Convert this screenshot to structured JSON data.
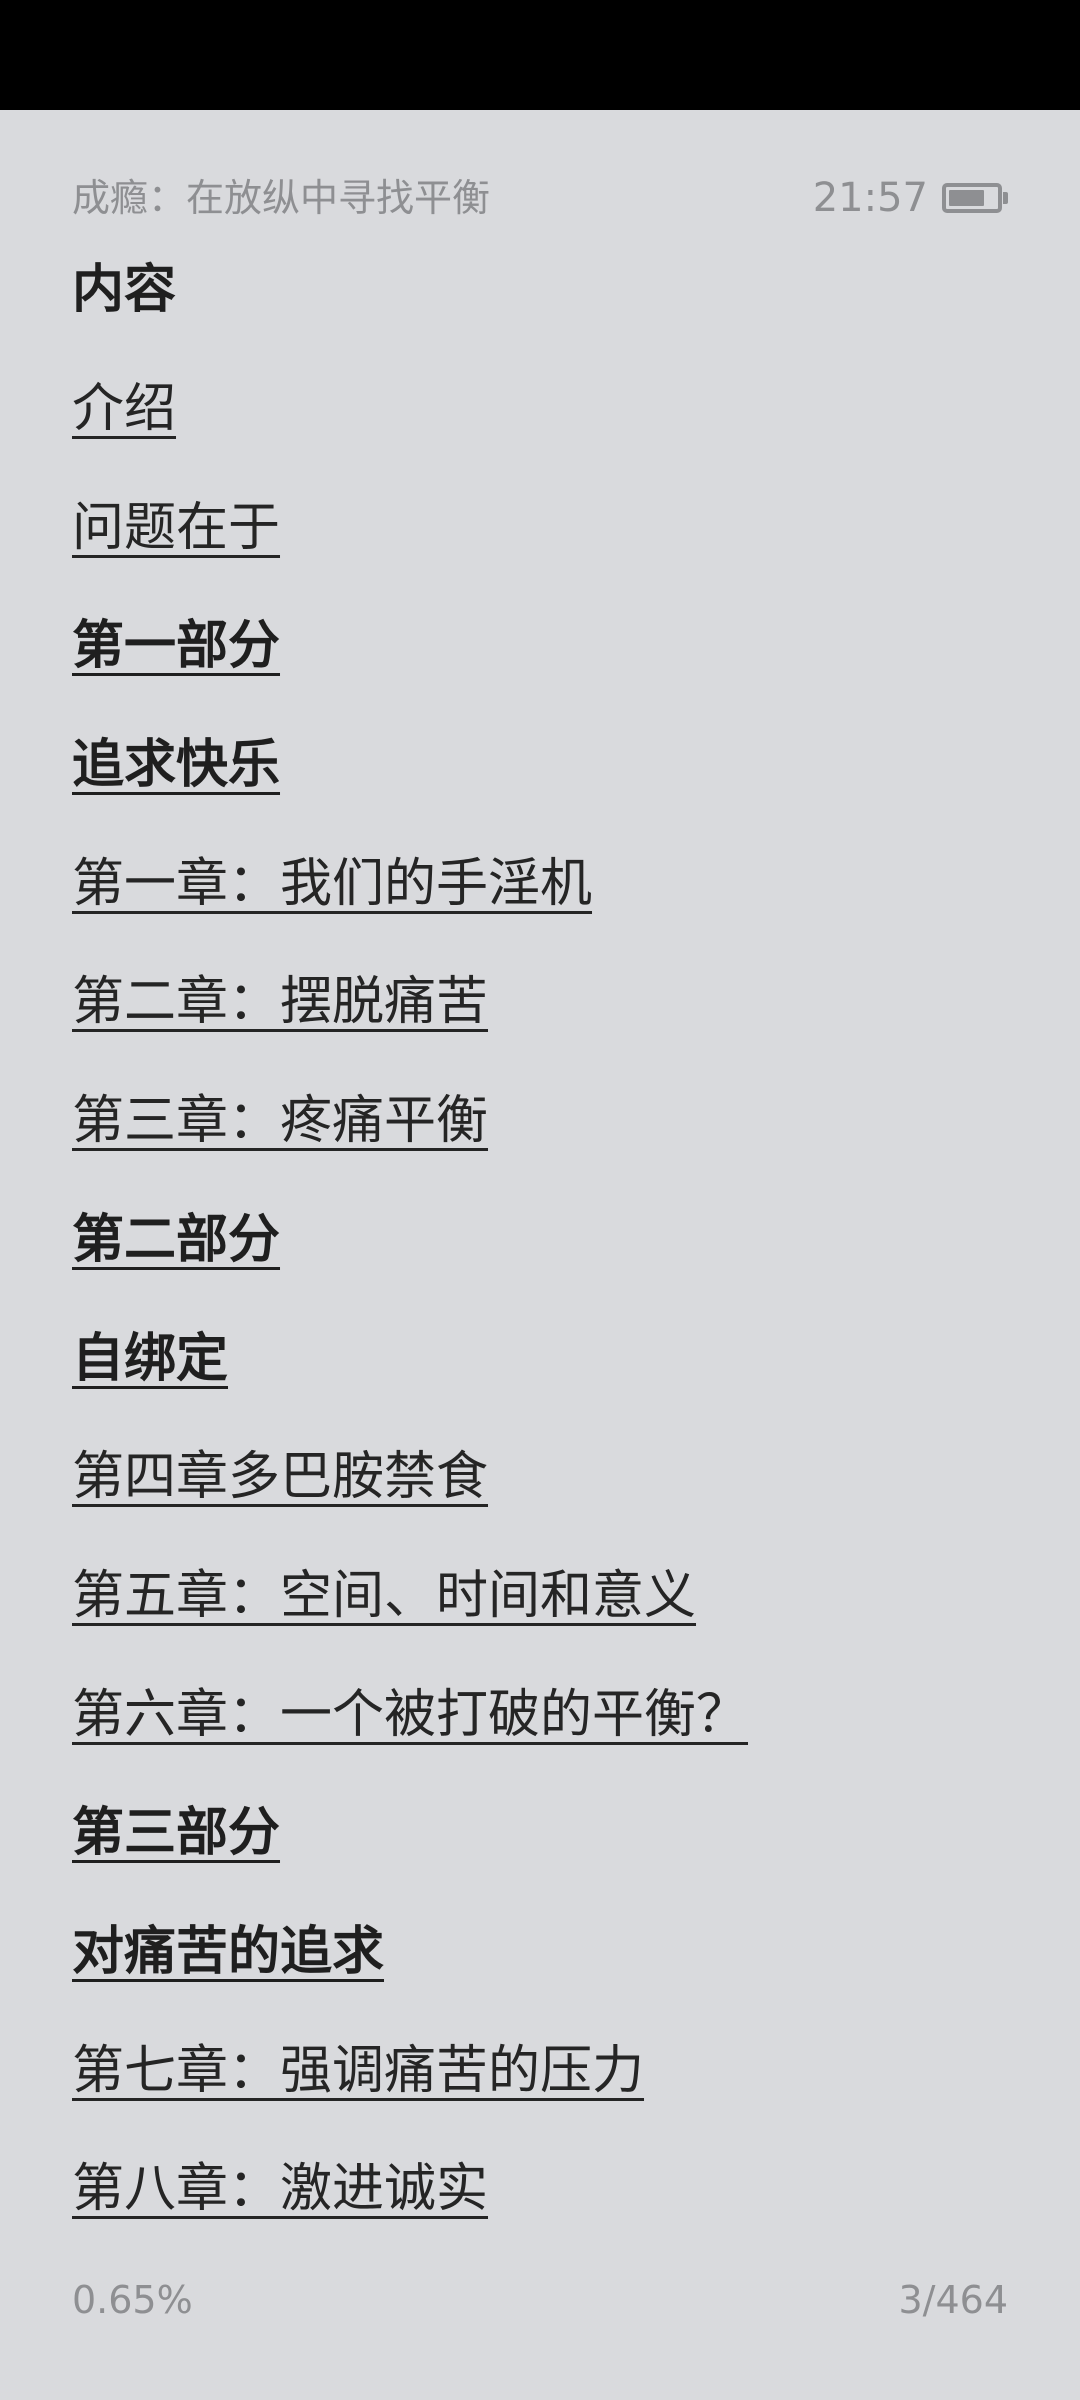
{
  "header": {
    "book_title": "成瘾：在放纵中寻找平衡",
    "time": "21:57",
    "battery_icon": "battery-icon",
    "battery_level": 0.75
  },
  "toc": {
    "heading": "内容",
    "items": [
      {
        "label": "介绍",
        "bold": false
      },
      {
        "label": "问题在于",
        "bold": false
      },
      {
        "label": "第一部分",
        "bold": true
      },
      {
        "label": "追求快乐",
        "bold": true
      },
      {
        "label": "第一章：我们的手淫机",
        "bold": false
      },
      {
        "label": "第二章：摆脱痛苦",
        "bold": false
      },
      {
        "label": "第三章：疼痛平衡",
        "bold": false
      },
      {
        "label": "第二部分",
        "bold": true
      },
      {
        "label": "自绑定",
        "bold": true
      },
      {
        "label": "第四章多巴胺禁食",
        "bold": false
      },
      {
        "label": "第五章：空间、时间和意义",
        "bold": false
      },
      {
        "label": "第六章：一个被打破的平衡？",
        "bold": false
      },
      {
        "label": "第三部分",
        "bold": true
      },
      {
        "label": "对痛苦的追求",
        "bold": true
      },
      {
        "label": "第七章：强调痛苦的压力",
        "bold": false
      },
      {
        "label": "第八章：激进诚实",
        "bold": false
      }
    ]
  },
  "footer": {
    "progress": "0.65%",
    "page": "3/464"
  },
  "colors": {
    "background": "#d9dadd",
    "text": "#252525",
    "muted": "#8e8f92",
    "status_bar": "#000000"
  }
}
